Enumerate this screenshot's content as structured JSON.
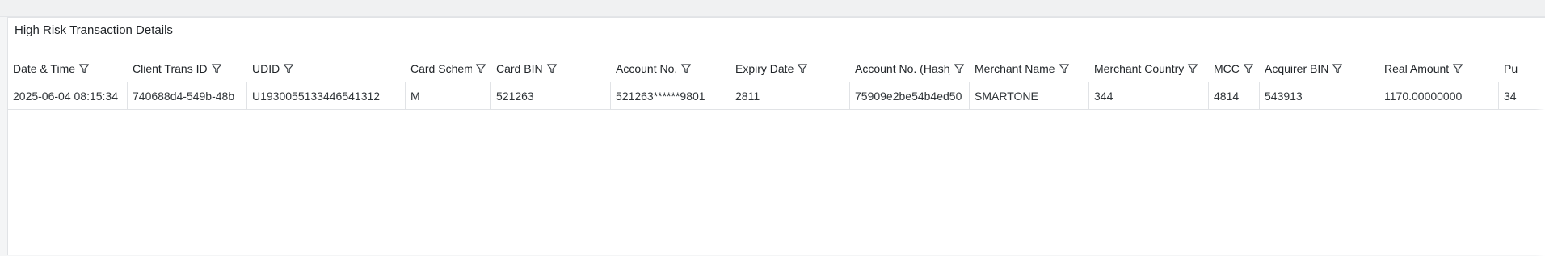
{
  "panel": {
    "title": "High Risk Transaction Details"
  },
  "table": {
    "columns": [
      {
        "key": "date_time",
        "label": "Date & Time"
      },
      {
        "key": "client_trans_id",
        "label": "Client Trans ID"
      },
      {
        "key": "udid",
        "label": "UDID"
      },
      {
        "key": "card_scheme",
        "label": "Card Scheme"
      },
      {
        "key": "card_bin",
        "label": "Card BIN"
      },
      {
        "key": "account_no",
        "label": "Account No."
      },
      {
        "key": "expiry_date",
        "label": "Expiry Date"
      },
      {
        "key": "account_no_hash",
        "label": "Account No. (Hash)"
      },
      {
        "key": "merchant_name",
        "label": "Merchant Name"
      },
      {
        "key": "merchant_country",
        "label": "Merchant Country"
      },
      {
        "key": "mcc",
        "label": "MCC"
      },
      {
        "key": "acquirer_bin",
        "label": "Acquirer BIN"
      },
      {
        "key": "real_amount",
        "label": "Real Amount"
      },
      {
        "key": "pu",
        "label": "Pu"
      }
    ],
    "rows": [
      [
        "2025-06-04 08:15:34",
        "740688d4-549b-48b",
        "U1930055133446541312",
        "M",
        "521263",
        "521263******9801",
        "2811",
        "75909e2be54b4ed50",
        "SMARTONE",
        "344",
        "4814",
        "543913",
        "1170.00000000",
        "34"
      ]
    ]
  },
  "icons": {
    "filter": "filter-funnel-icon"
  },
  "colors": {
    "grid_border": "#e1e3e6",
    "text": "#2b2f33",
    "background": "#f4f5f6"
  }
}
